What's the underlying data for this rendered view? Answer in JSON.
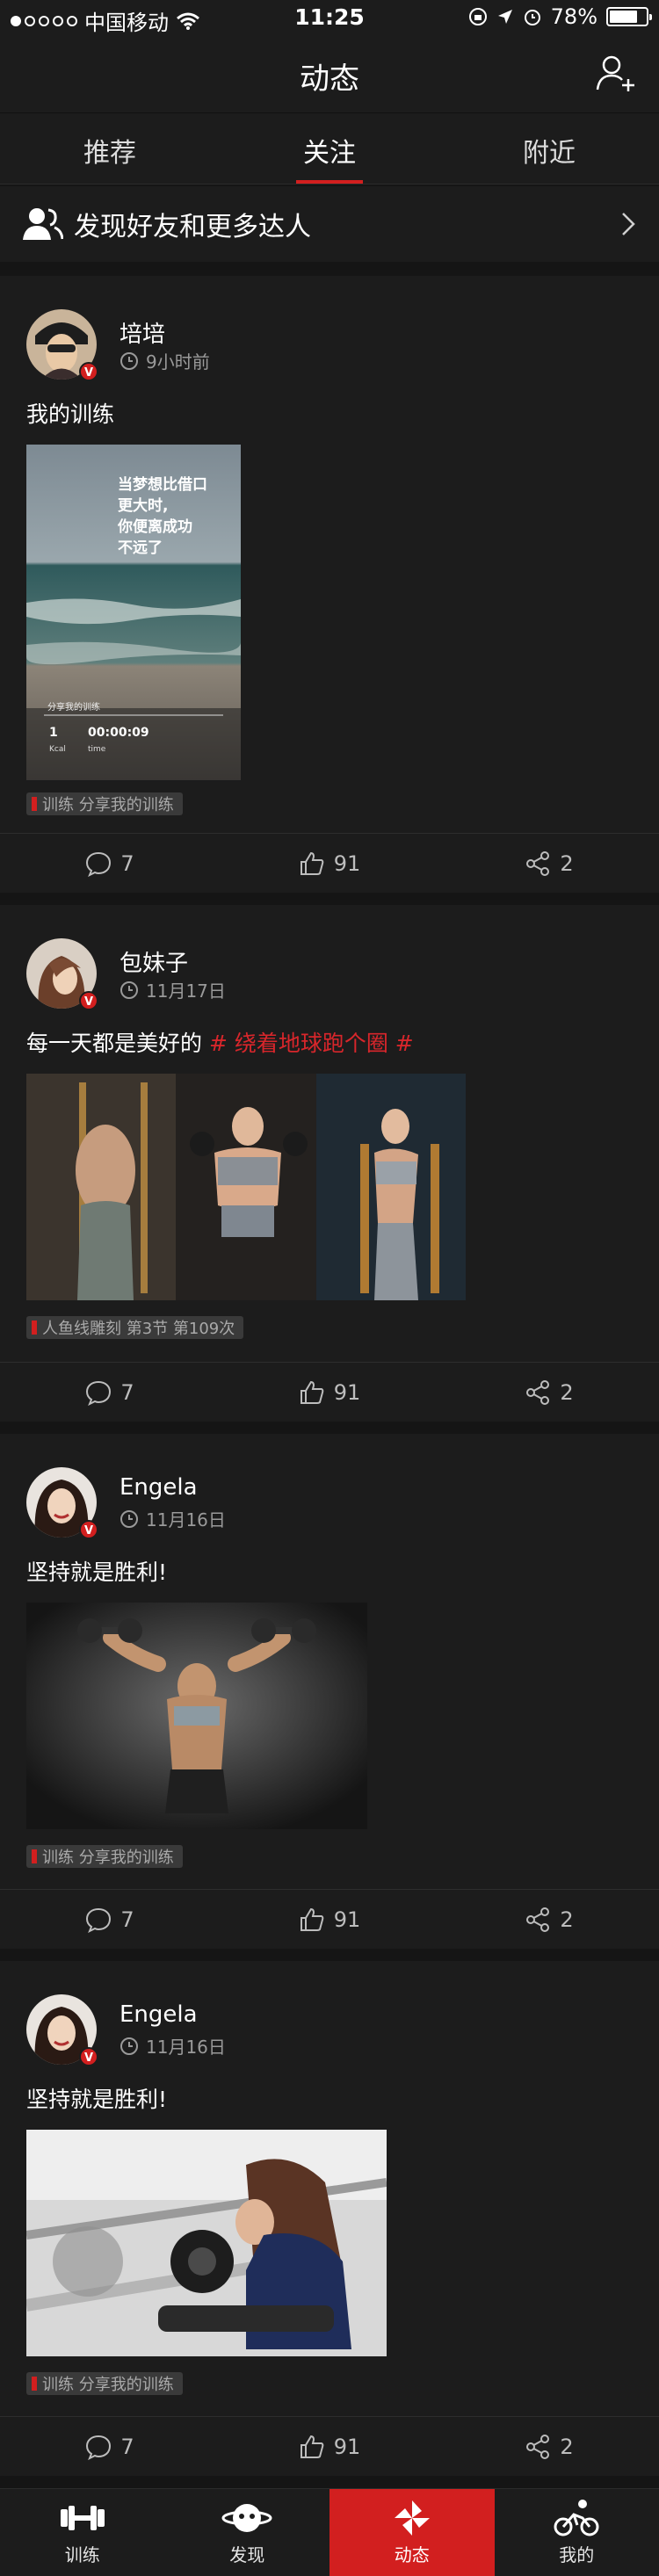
{
  "status_bar": {
    "carrier": "中国移动",
    "time": "11:25",
    "battery": "78%",
    "battery_level": 0.78
  },
  "nav": {
    "title": "动态"
  },
  "tabs": [
    {
      "label": "推荐",
      "active": false
    },
    {
      "label": "关注",
      "active": true
    },
    {
      "label": "附近",
      "active": false
    }
  ],
  "discover": {
    "label": "发现好友和更多达人"
  },
  "posts": [
    {
      "name": "培培",
      "time": "9小时前",
      "text": "我的训练",
      "topic": "",
      "chip": "训练 分享我的训练",
      "poster": {
        "headline_1": "当梦想比借口",
        "headline_2": "更大时,",
        "headline_3": "你便离成功",
        "headline_4": "不远了",
        "caption": "分享我的训练",
        "stat_1_value": "1",
        "stat_1_unit": "Kcal",
        "stat_2_value": "00:00:09",
        "stat_2_unit": "time"
      },
      "comments": "7",
      "likes": "91",
      "shares": "2"
    },
    {
      "name": "包妹子",
      "time": "11月17日",
      "text": "每一天都是美好的",
      "topic": "# 绕着地球跑个圈 #",
      "chip": "人鱼线雕刻 第3节 第109次",
      "comments": "7",
      "likes": "91",
      "shares": "2"
    },
    {
      "name": "Engela",
      "time": "11月16日",
      "text": "坚持就是胜利!",
      "topic": "",
      "chip": "训练 分享我的训练",
      "comments": "7",
      "likes": "91",
      "shares": "2"
    },
    {
      "name": "Engela",
      "time": "11月16日",
      "text": "坚持就是胜利!",
      "topic": "",
      "chip": "训练 分享我的训练",
      "comments": "7",
      "likes": "91",
      "shares": "2"
    }
  ],
  "tabbar": [
    {
      "label": "训练",
      "icon": "dumbbell-icon",
      "active": false
    },
    {
      "label": "发现",
      "icon": "planet-icon",
      "active": false
    },
    {
      "label": "动态",
      "icon": "pinwheel-icon",
      "active": true
    },
    {
      "label": "我的",
      "icon": "cyclist-icon",
      "active": false
    }
  ],
  "colors": {
    "accent": "#d21f1f",
    "background": "#151515",
    "card": "#1c1c1c"
  }
}
